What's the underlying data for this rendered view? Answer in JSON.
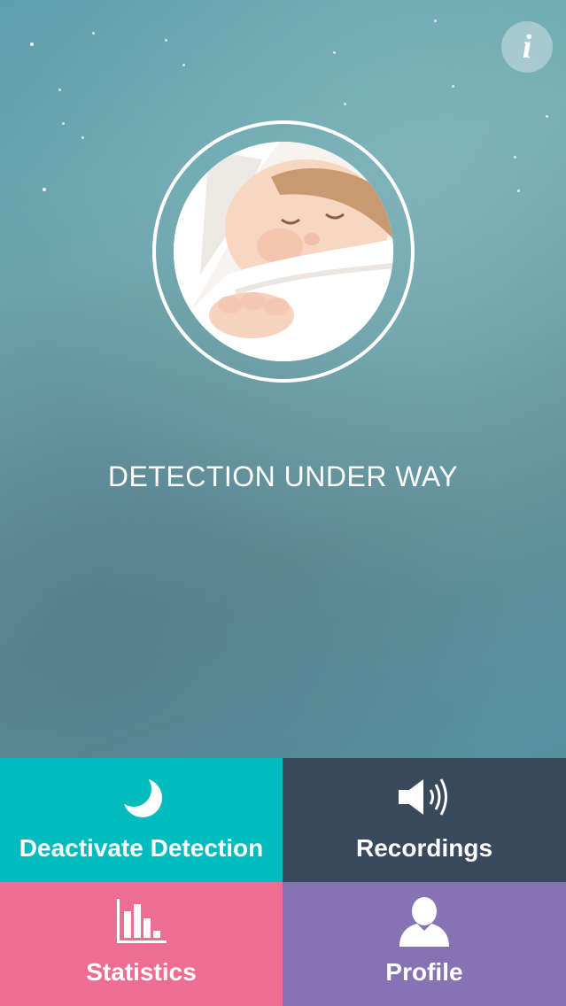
{
  "status": {
    "text": "DETECTION UNDER WAY"
  },
  "info_button": {
    "glyph": "i",
    "icon": "info-icon"
  },
  "avatar": {
    "icon": "sleeping-baby-photo"
  },
  "tiles": [
    {
      "label": "Deactivate Detection",
      "icon": "moon-icon",
      "color": "#00bcbe"
    },
    {
      "label": "Recordings",
      "icon": "speaker-icon",
      "color": "#3a4a5d"
    },
    {
      "label": "Statistics",
      "icon": "bar-chart-icon",
      "color": "#ef6d93"
    },
    {
      "label": "Profile",
      "icon": "person-icon",
      "color": "#8773b3"
    }
  ],
  "colors": {
    "background_top": "#6fa8b0",
    "background_bottom": "#4f93a4",
    "text": "#ffffff"
  }
}
